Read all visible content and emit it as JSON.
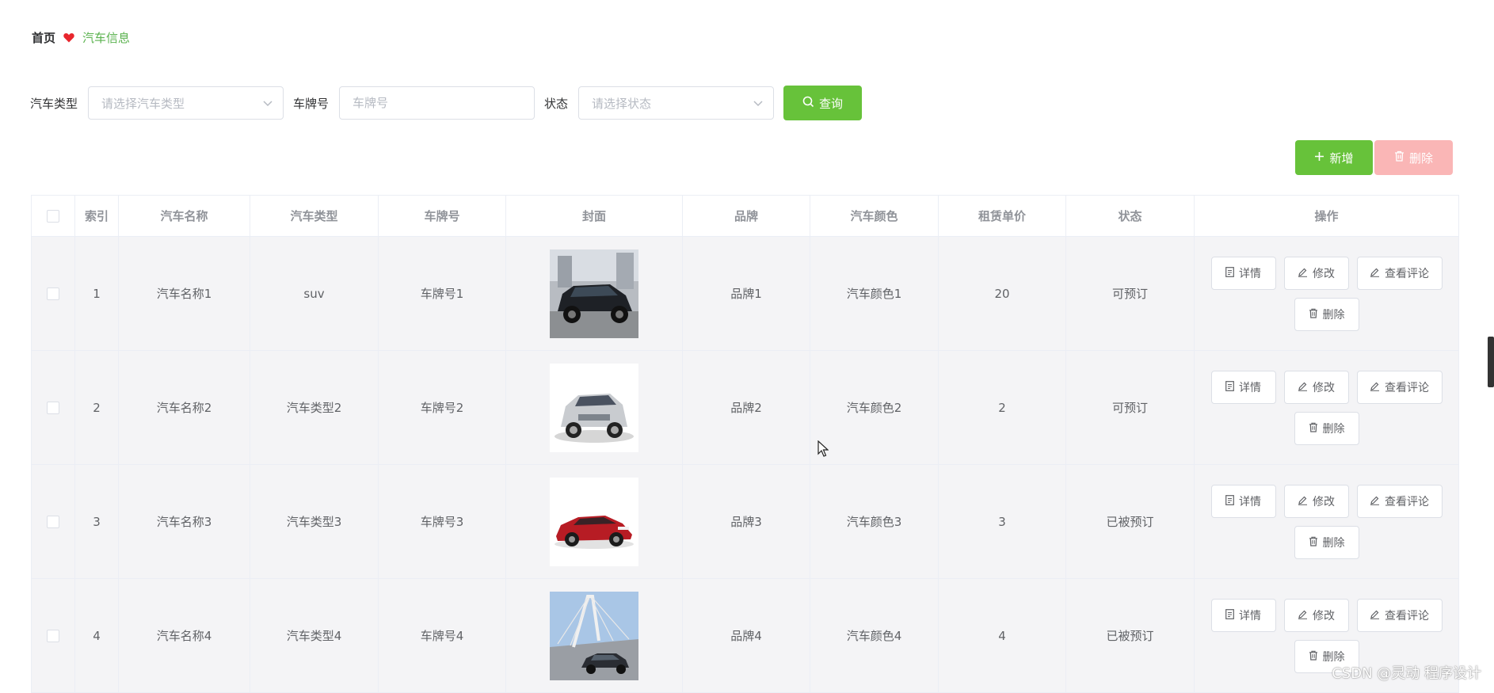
{
  "breadcrumb": {
    "home": "首页",
    "current": "汽车信息"
  },
  "filters": {
    "car_type_label": "汽车类型",
    "car_type_placeholder": "请选择汽车类型",
    "plate_label": "车牌号",
    "plate_placeholder": "车牌号",
    "status_label": "状态",
    "status_placeholder": "请选择状态",
    "query_label": "查询"
  },
  "actions": {
    "add_label": "新增",
    "delete_label": "删除"
  },
  "table": {
    "headers": [
      "索引",
      "汽车名称",
      "汽车类型",
      "车牌号",
      "封面",
      "品牌",
      "汽车颜色",
      "租赁单价",
      "状态",
      "操作"
    ],
    "rows": [
      {
        "index": "1",
        "name": "汽车名称1",
        "type": "suv",
        "plate": "车牌号1",
        "brand": "品牌1",
        "color": "汽车颜色1",
        "price": "20",
        "status": "可预订"
      },
      {
        "index": "2",
        "name": "汽车名称2",
        "type": "汽车类型2",
        "plate": "车牌号2",
        "brand": "品牌2",
        "color": "汽车颜色2",
        "price": "2",
        "status": "可预订"
      },
      {
        "index": "3",
        "name": "汽车名称3",
        "type": "汽车类型3",
        "plate": "车牌号3",
        "brand": "品牌3",
        "color": "汽车颜色3",
        "price": "3",
        "status": "已被预订"
      },
      {
        "index": "4",
        "name": "汽车名称4",
        "type": "汽车类型4",
        "plate": "车牌号4",
        "brand": "品牌4",
        "color": "汽车颜色4",
        "price": "4",
        "status": "已被预订"
      }
    ],
    "row_actions": {
      "detail": "详情",
      "edit": "修改",
      "reviews": "查看评论",
      "delete": "删除"
    }
  },
  "watermark": "CSDN @灵动 程序设计",
  "colors": {
    "primary": "#67c23a",
    "danger_disabled": "#fab6b6",
    "breadcrumb_active": "#5ab24e",
    "heart": "#e8262d"
  },
  "icons": {
    "heart": "heart-icon",
    "search": "search-icon",
    "plus": "plus-icon",
    "trash": "trash-icon",
    "document": "document-icon",
    "edit": "edit-icon",
    "chevron": "chevron-down-icon"
  }
}
